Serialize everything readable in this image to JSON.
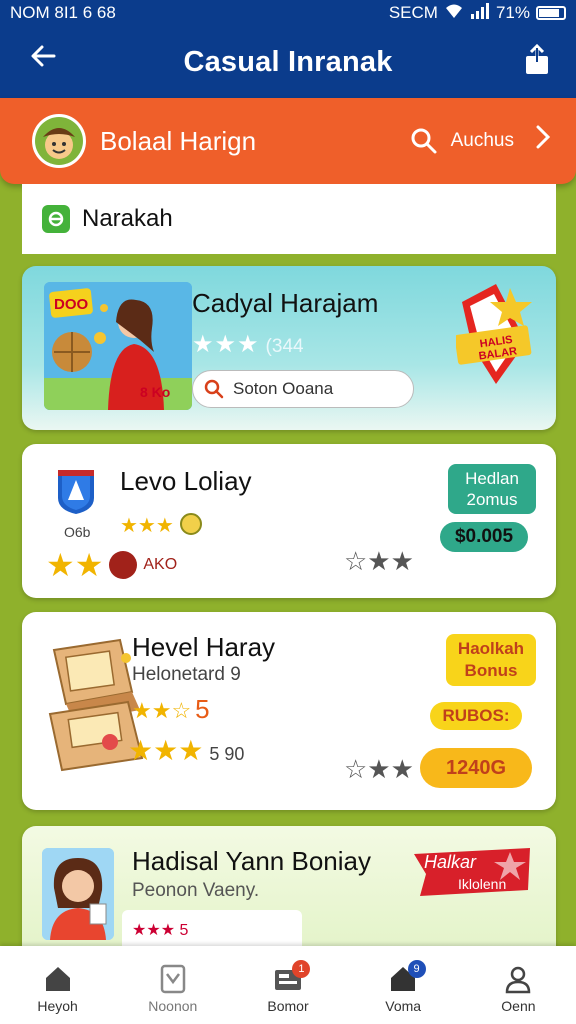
{
  "status_bar": {
    "left": "NOM 8I1 6  68",
    "right": "SECM",
    "battery": "71%"
  },
  "app_bar": {
    "title": "Casual Inranak"
  },
  "banner": {
    "title": "Bolaal Harign",
    "more_label": "Auchus"
  },
  "section": {
    "label": "Narakah"
  },
  "cards": [
    {
      "title": "Cadyal Harajam",
      "rating_stars": "★★★",
      "rating_value": "(344",
      "search_placeholder": "Soton Ooana",
      "thumb_tag": "DOO",
      "thumb_badge": "8 Ko",
      "badge_text": "HALIS BALAR"
    },
    {
      "title": "Levo Loliay",
      "sublabel": "O6b",
      "stars_a": "★★★",
      "stars_b": "★★",
      "stars_b_text": "AKO",
      "stars_c": "☆★★",
      "tag": "Hedlan 2omus",
      "price": "$0.005"
    },
    {
      "title": "Hevel Haray",
      "subtitle": "Helonetard 9",
      "stars_a": "★★☆",
      "stars_a_num": "5",
      "stars_b": "★★★",
      "stars_b_num": "5 90",
      "stars_c": "☆★★",
      "tag": "Haolkah Bonus",
      "pill": "RUBOS:",
      "price": "1240G"
    },
    {
      "title": "Hadisal Yann Boniay",
      "subtitle": "Peonon Vaeny.",
      "row_text": "★★★ 5",
      "ribbon_text_1": "Halkar",
      "ribbon_text_2": "Iklolenn"
    }
  ],
  "nav": [
    {
      "label": "Heyoh",
      "icon": "home-icon"
    },
    {
      "label": "Noonon",
      "icon": "tablet-icon"
    },
    {
      "label": "Bomor",
      "icon": "inbox-icon",
      "badge": "1"
    },
    {
      "label": "Voma",
      "icon": "home-icon",
      "badge": "9"
    },
    {
      "label": "Oenn",
      "icon": "profile-icon"
    }
  ],
  "colors": {
    "primary": "#0b3c8c",
    "accent": "#ef5f2a",
    "background": "#8fb12c",
    "teal": "#2fa88a",
    "yellow": "#f8d41a"
  }
}
